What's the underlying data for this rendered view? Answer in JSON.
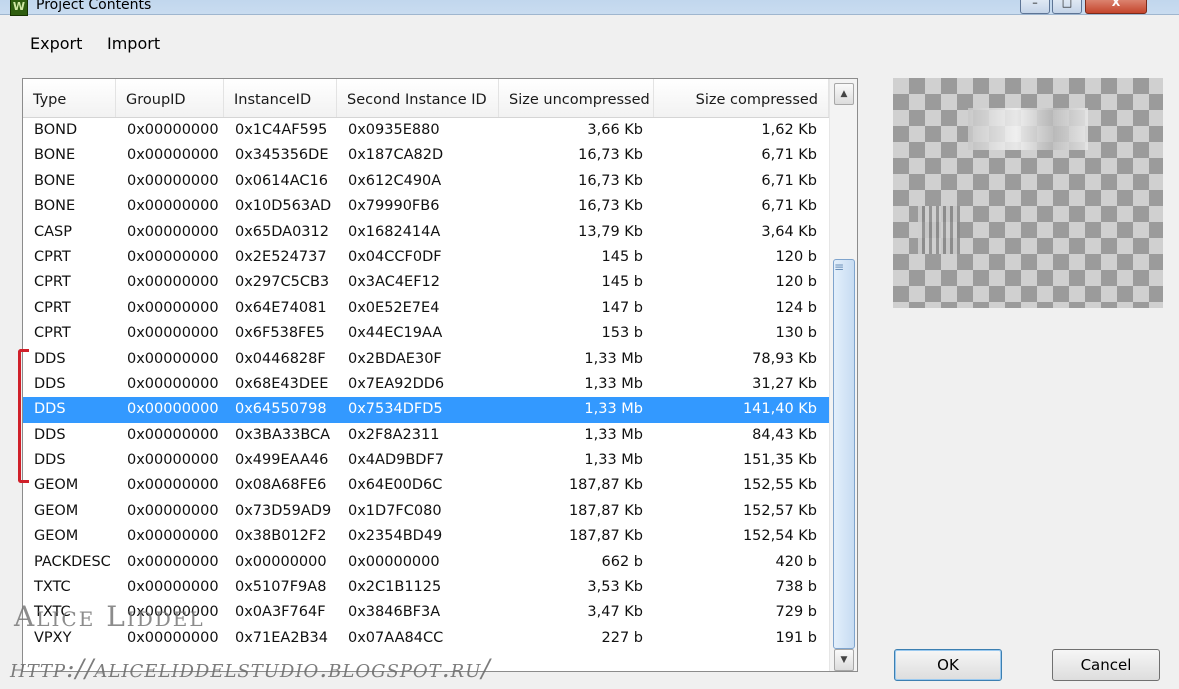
{
  "window": {
    "title": "Project Contents",
    "icon_letter": "W",
    "controls": {
      "minimize": "–",
      "maximize": "□",
      "close": "X"
    }
  },
  "menu": {
    "items": [
      "Export",
      "Import"
    ]
  },
  "table": {
    "columns": [
      "Type",
      "GroupID",
      "InstanceID",
      "Second Instance ID",
      "Size uncompressed",
      "Size compressed"
    ],
    "selected_index": 11,
    "rows": [
      [
        "BOND",
        "0x00000000",
        "0x1C4AF595",
        "0x0935E880",
        "3,66 Kb",
        "1,62 Kb"
      ],
      [
        "BONE",
        "0x00000000",
        "0x345356DE",
        "0x187CA82D",
        "16,73 Kb",
        "6,71 Kb"
      ],
      [
        "BONE",
        "0x00000000",
        "0x0614AC16",
        "0x612C490A",
        "16,73 Kb",
        "6,71 Kb"
      ],
      [
        "BONE",
        "0x00000000",
        "0x10D563AD",
        "0x79990FB6",
        "16,73 Kb",
        "6,71 Kb"
      ],
      [
        "CASP",
        "0x00000000",
        "0x65DA0312",
        "0x1682414A",
        "13,79 Kb",
        "3,64 Kb"
      ],
      [
        "CPRT",
        "0x00000000",
        "0x2E524737",
        "0x04CCF0DF",
        "145 b",
        "120 b"
      ],
      [
        "CPRT",
        "0x00000000",
        "0x297C5CB3",
        "0x3AC4EF12",
        "145 b",
        "120 b"
      ],
      [
        "CPRT",
        "0x00000000",
        "0x64E74081",
        "0x0E52E7E4",
        "147 b",
        "124 b"
      ],
      [
        "CPRT",
        "0x00000000",
        "0x6F538FE5",
        "0x44EC19AA",
        "153 b",
        "130 b"
      ],
      [
        "DDS",
        "0x00000000",
        "0x0446828F",
        "0x2BDAE30F",
        "1,33 Mb",
        "78,93 Kb"
      ],
      [
        "DDS",
        "0x00000000",
        "0x68E43DEE",
        "0x7EA92DD6",
        "1,33 Mb",
        "31,27 Kb"
      ],
      [
        "DDS",
        "0x00000000",
        "0x64550798",
        "0x7534DFD5",
        "1,33 Mb",
        "141,40 Kb"
      ],
      [
        "DDS",
        "0x00000000",
        "0x3BA33BCA",
        "0x2F8A2311",
        "1,33 Mb",
        "84,43 Kb"
      ],
      [
        "DDS",
        "0x00000000",
        "0x499EAA46",
        "0x4AD9BDF7",
        "1,33 Mb",
        "151,35 Kb"
      ],
      [
        "GEOM",
        "0x00000000",
        "0x08A68FE6",
        "0x64E00D6C",
        "187,87 Kb",
        "152,55 Kb"
      ],
      [
        "GEOM",
        "0x00000000",
        "0x73D59AD9",
        "0x1D7FC080",
        "187,87 Kb",
        "152,57 Kb"
      ],
      [
        "GEOM",
        "0x00000000",
        "0x38B012F2",
        "0x2354BD49",
        "187,87 Kb",
        "152,54 Kb"
      ],
      [
        "PACKDESC",
        "0x00000000",
        "0x00000000",
        "0x00000000",
        "662 b",
        "420 b"
      ],
      [
        "TXTC",
        "0x00000000",
        "0x5107F9A8",
        "0x2C1B1125",
        "3,53 Kb",
        "738 b"
      ],
      [
        "TXTC",
        "0x00000000",
        "0x0A3F764F",
        "0x3846BF3A",
        "3,47 Kb",
        "729 b"
      ],
      [
        "VPXY",
        "0x00000000",
        "0x71EA2B34",
        "0x07AA84CC",
        "227 b",
        "191 b"
      ]
    ]
  },
  "scrollbar": {
    "up_glyph": "▲",
    "down_glyph": "▼",
    "position_fraction": 0.7
  },
  "buttons": {
    "ok": "OK",
    "cancel": "Cancel"
  },
  "watermark": {
    "name": "Alice Liddel",
    "url": "http://aliceliddelstudio.blogspot.ru/"
  },
  "colors": {
    "selection": "#3399ff",
    "annotation_bracket": "#d0202a"
  }
}
